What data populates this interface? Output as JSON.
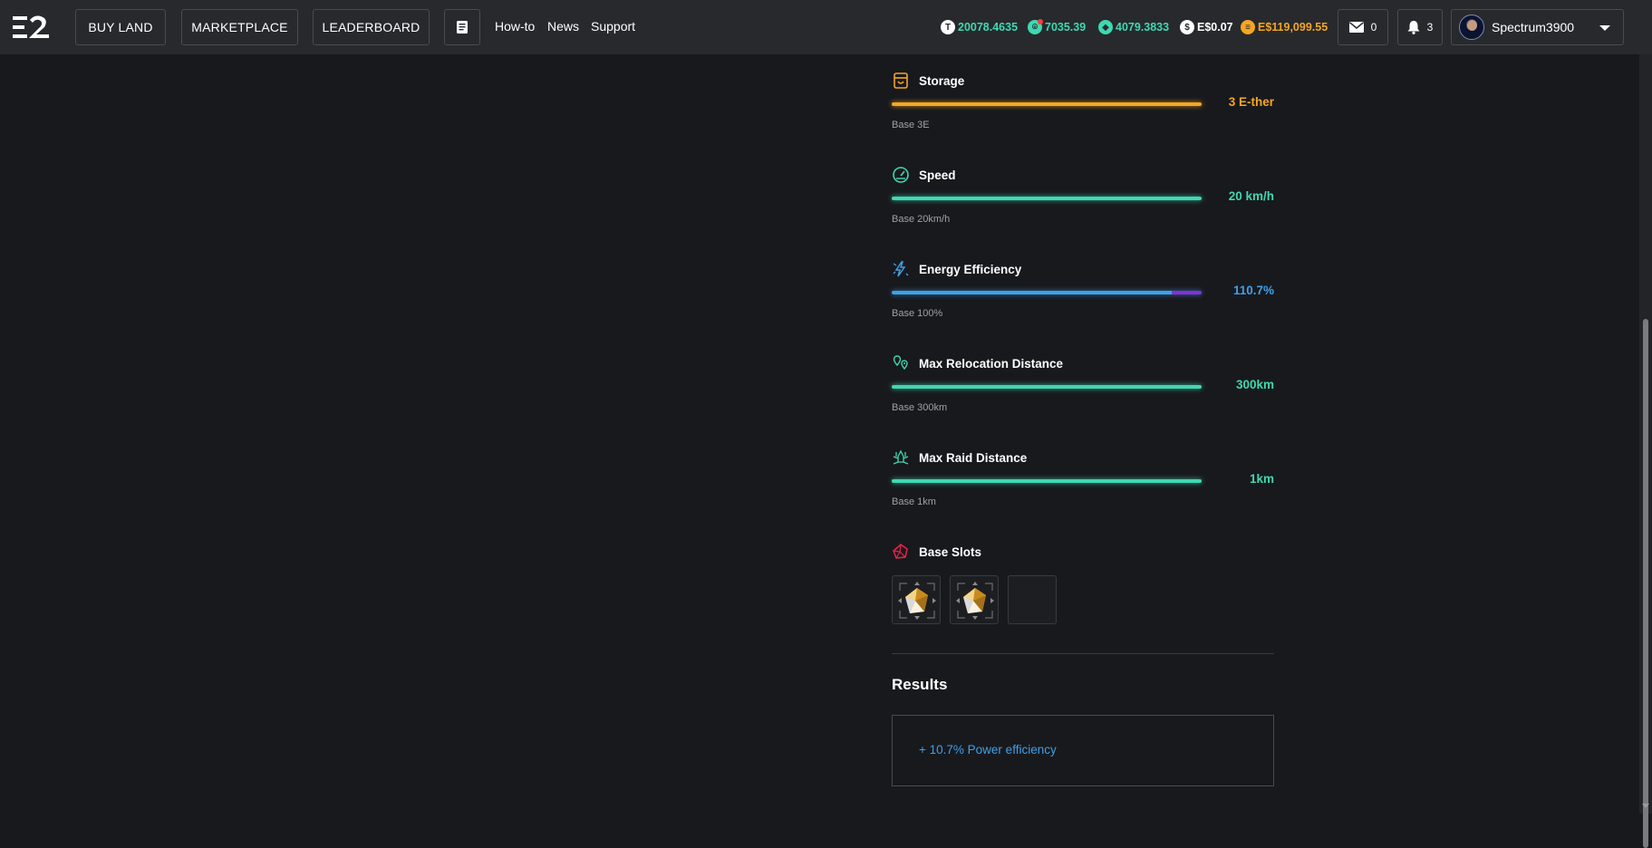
{
  "header": {
    "buy_land": "BUY LAND",
    "marketplace": "MARKETPLACE",
    "leaderboard": "LEADERBOARD",
    "howto": "How-to",
    "news": "News",
    "support": "Support",
    "balances": [
      {
        "icon": "tile-icon",
        "value": "20078.4635"
      },
      {
        "icon": "energy-icon",
        "value": "7035.39"
      },
      {
        "icon": "ether-icon",
        "value": "4079.3833"
      },
      {
        "icon": "dollar-icon",
        "value": "E$0.07"
      },
      {
        "icon": "essence-icon",
        "value": "E$119,099.55"
      }
    ],
    "mail_count": "0",
    "notification_count": "3",
    "username": "Spectrum3900"
  },
  "stats": [
    {
      "name": "Storage",
      "value": "3 E-ther",
      "base": "Base 3E",
      "color": "#f5a623"
    },
    {
      "name": "Speed",
      "value": "20 km/h",
      "base": "Base 20km/h",
      "color": "#3fd8b2"
    },
    {
      "name": "Energy Efficiency",
      "value": "110.7%",
      "base": "Base 100%",
      "color": "#3ea0e8",
      "bonus_color": "#8a2be2"
    },
    {
      "name": "Max Relocation Distance",
      "value": "300km",
      "base": "Base 300km",
      "color": "#3fd8b2"
    },
    {
      "name": "Max Raid Distance",
      "value": "1km",
      "base": "Base 1km",
      "color": "#3fd8b2"
    }
  ],
  "base_slots": {
    "title": "Base Slots",
    "slots": [
      {
        "filled": true,
        "icon": "crystal-icon"
      },
      {
        "filled": true,
        "icon": "crystal-icon"
      },
      {
        "filled": false
      }
    ]
  },
  "results": {
    "title": "Results",
    "lines": [
      "+ 10.7% Power efficiency"
    ]
  }
}
